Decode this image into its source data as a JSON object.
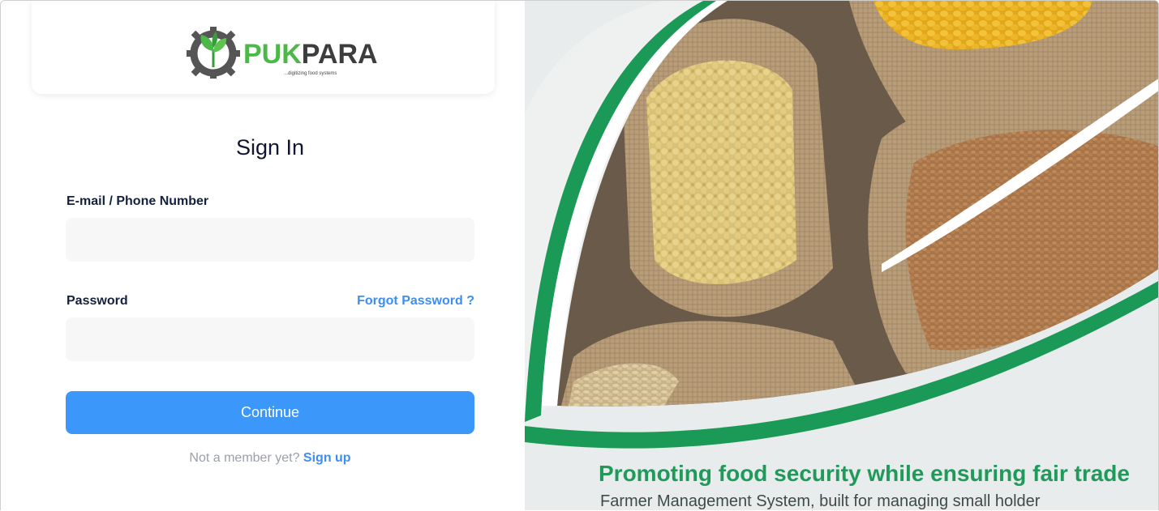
{
  "brand": {
    "name_part1": "PUK",
    "name_part2": "PARA",
    "tagline": "...digitizing food systems"
  },
  "form": {
    "title": "Sign In",
    "email_label": "E-mail / Phone Number",
    "email_value": "",
    "password_label": "Password",
    "password_value": "",
    "forgot_label": "Forgot Password ?",
    "continue_label": "Continue",
    "signup_prompt": "Not a member yet?",
    "signup_link": "Sign up"
  },
  "hero": {
    "headline": "Promoting food security while ensuring fair trade",
    "subtext": "Farmer Management System, built for managing small holder"
  },
  "colors": {
    "accent_blue": "#3c97fb",
    "link_blue": "#3d8ef0",
    "brand_green": "#1f9a5a",
    "title_navy": "#0f1632"
  }
}
